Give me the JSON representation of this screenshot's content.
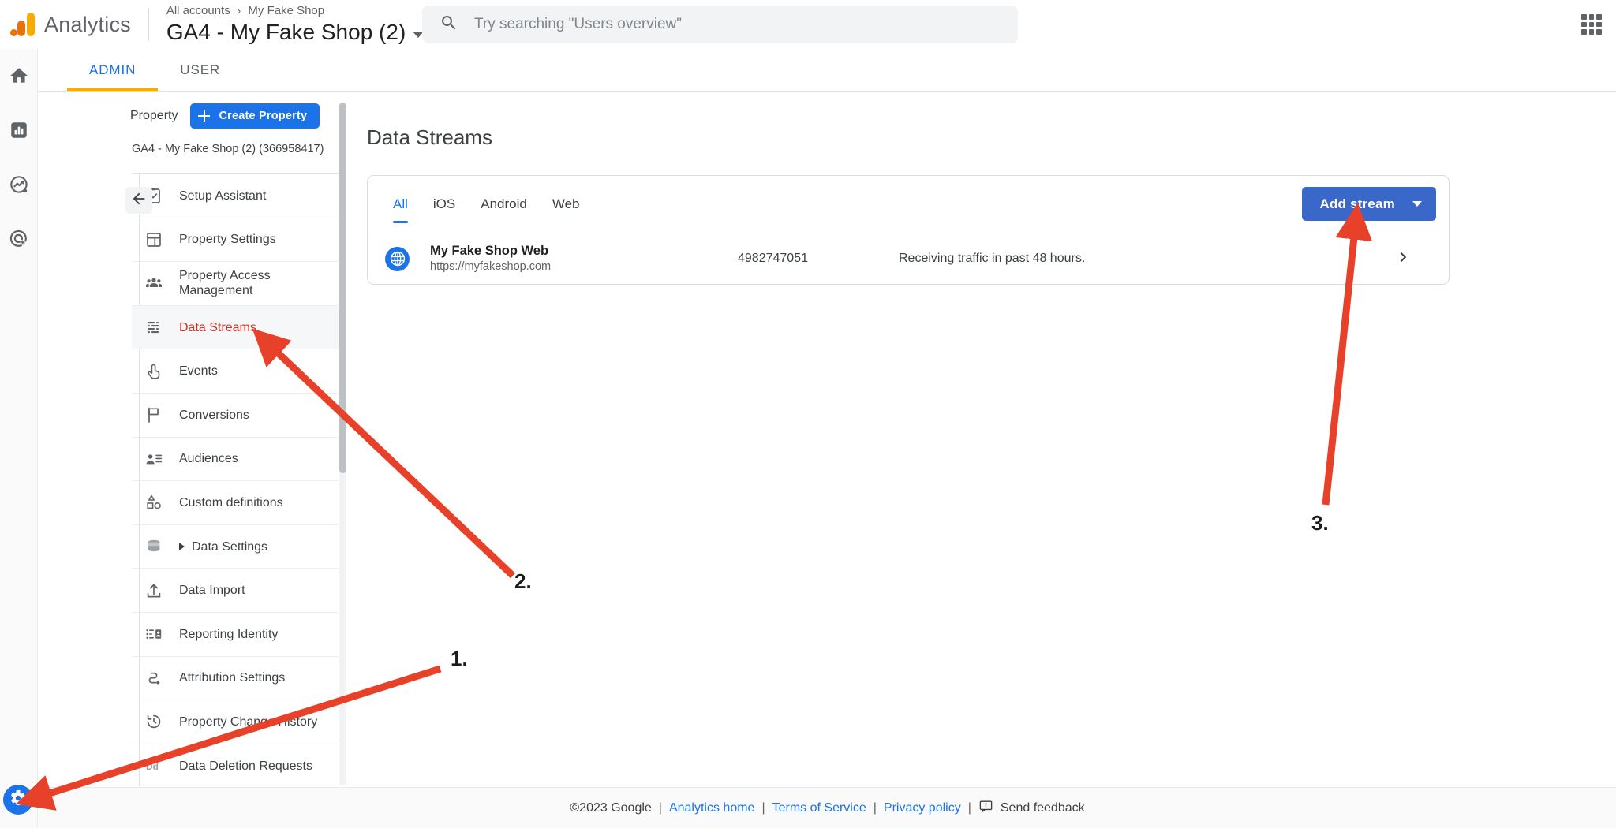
{
  "topbar": {
    "brand": "Analytics",
    "logo_icon": "google-analytics-logo",
    "breadcrumb": {
      "account": "All accounts",
      "separator": "›",
      "property": "My Fake Shop"
    },
    "property_title": "GA4 - My Fake Shop (2)",
    "property_dropdown_icon": "caret-down-icon",
    "search": {
      "icon": "search-icon",
      "placeholder": "Try searching \"Users overview\"",
      "value": ""
    },
    "apps_icon": "apps-grid-icon"
  },
  "rail": {
    "items": [
      {
        "icon": "home-icon",
        "name": "home"
      },
      {
        "icon": "reports-bar-chart-icon",
        "name": "reports"
      },
      {
        "icon": "explore-trend-icon",
        "name": "explore"
      },
      {
        "icon": "advertising-target-icon",
        "name": "advertising"
      }
    ],
    "admin_fab": {
      "icon": "gear-icon",
      "color": "#1a73e8"
    }
  },
  "tabs": [
    {
      "label": "ADMIN",
      "active": true
    },
    {
      "label": "USER",
      "active": false
    }
  ],
  "admin_panel": {
    "property_label": "Property",
    "create_property_label": "Create Property",
    "create_property_icon": "plus-icon",
    "property_id_line": "GA4 - My Fake Shop (2) (366958417)",
    "collapse_icon": "arrow-left-icon",
    "menu": [
      {
        "label": "Setup Assistant",
        "icon": "clipboard-check-icon",
        "selected": false,
        "expandable": false
      },
      {
        "label": "Property Settings",
        "icon": "property-layout-icon",
        "selected": false,
        "expandable": false
      },
      {
        "label": "Property Access Management",
        "icon": "people-icon",
        "selected": false,
        "expandable": false
      },
      {
        "label": "Data Streams",
        "icon": "data-streams-icon",
        "selected": true,
        "expandable": false
      },
      {
        "label": "Events",
        "icon": "tap-hand-icon",
        "selected": false,
        "expandable": false
      },
      {
        "label": "Conversions",
        "icon": "flag-icon",
        "selected": false,
        "expandable": false
      },
      {
        "label": "Audiences",
        "icon": "person-list-icon",
        "selected": false,
        "expandable": false
      },
      {
        "label": "Custom definitions",
        "icon": "shapes-icon",
        "selected": false,
        "expandable": false
      },
      {
        "label": "Data Settings",
        "icon": "database-icon",
        "selected": false,
        "expandable": true
      },
      {
        "label": "Data Import",
        "icon": "upload-icon",
        "selected": false,
        "expandable": false
      },
      {
        "label": "Reporting Identity",
        "icon": "reporting-identity-icon",
        "selected": false,
        "expandable": false
      },
      {
        "label": "Attribution Settings",
        "icon": "attribution-path-icon",
        "selected": false,
        "expandable": false
      },
      {
        "label": "Property Change History",
        "icon": "history-clock-icon",
        "selected": false,
        "expandable": false
      },
      {
        "label": "Data Deletion Requests",
        "icon": "dd-icon",
        "selected": false,
        "expandable": false
      }
    ]
  },
  "main": {
    "page_title": "Data Streams",
    "filter_tabs": [
      {
        "label": "All",
        "active": true
      },
      {
        "label": "iOS",
        "active": false
      },
      {
        "label": "Android",
        "active": false
      },
      {
        "label": "Web",
        "active": false
      }
    ],
    "add_stream": {
      "label": "Add stream",
      "dropdown_icon": "caret-down-icon"
    },
    "streams": [
      {
        "icon": "globe-web-icon",
        "name": "My Fake Shop Web",
        "url": "https://myfakeshop.com",
        "stream_id": "4982747051",
        "status": "Receiving traffic in past 48 hours.",
        "chevron": "chevron-right-icon"
      }
    ]
  },
  "footer": {
    "copyright": "©2023 Google",
    "links": [
      {
        "label": "Analytics home"
      },
      {
        "label": "Terms of Service"
      },
      {
        "label": "Privacy policy"
      }
    ],
    "feedback": {
      "icon": "feedback-icon",
      "label": "Send feedback"
    }
  },
  "annotations": {
    "color": "#E8412A",
    "steps": [
      {
        "num": "1.",
        "target": "admin-gear-fab"
      },
      {
        "num": "2.",
        "target": "sidebar-item-data-streams"
      },
      {
        "num": "3.",
        "target": "add-stream-button"
      }
    ]
  }
}
